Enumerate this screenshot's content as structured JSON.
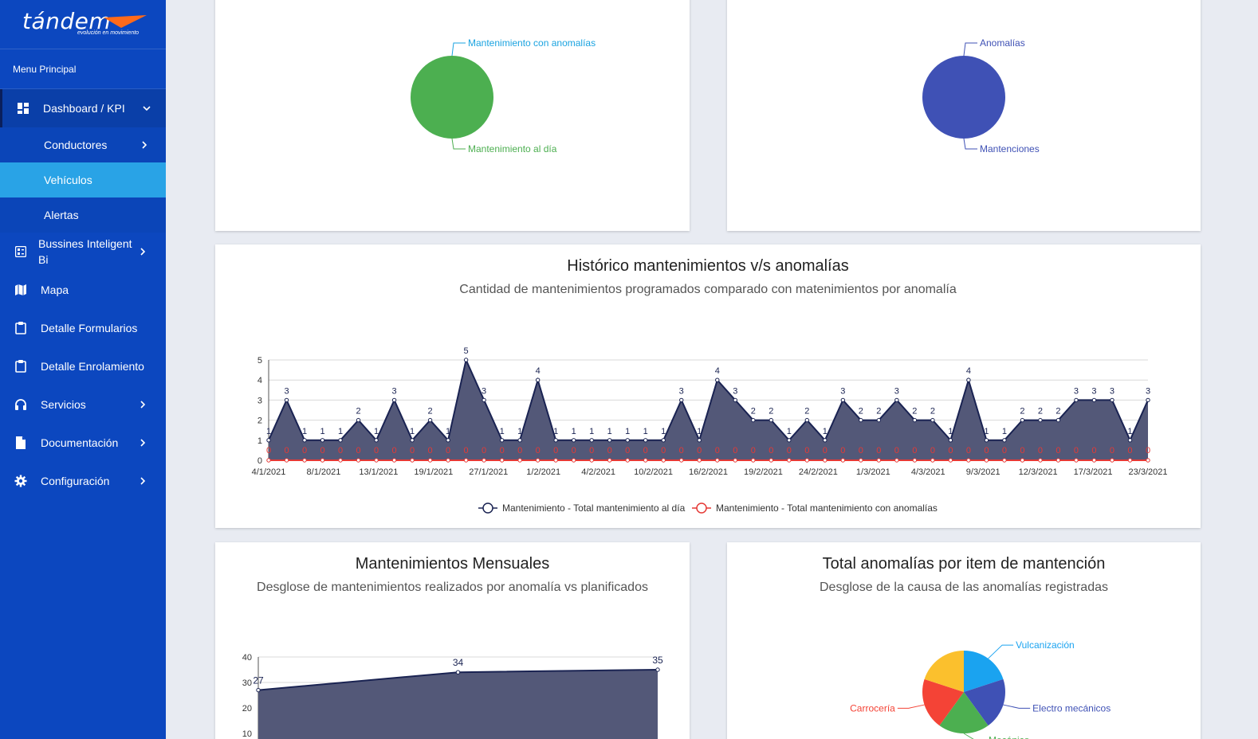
{
  "brand": {
    "name": "tándem",
    "tagline": "evolución en movimiento",
    "accent": "#ff6a1a"
  },
  "sidebar": {
    "header": "Menu Principal",
    "items": [
      {
        "label": "Dashboard / KPI",
        "icon": "dashboard-icon",
        "expanded": true
      },
      {
        "label": "Conductores",
        "sub": true,
        "chevron": true
      },
      {
        "label": "Vehículos",
        "sub": true,
        "selected": true
      },
      {
        "label": "Alertas",
        "sub": true
      },
      {
        "label": "Bussines Inteligent Bi",
        "icon": "bi-icon",
        "chevron": true
      },
      {
        "label": "Mapa",
        "icon": "map-icon"
      },
      {
        "label": "Detalle Formularios",
        "icon": "clipboard-icon"
      },
      {
        "label": "Detalle Enrolamiento",
        "icon": "clipboard-icon"
      },
      {
        "label": "Servicios",
        "icon": "headset-icon",
        "chevron": true
      },
      {
        "label": "Documentación",
        "icon": "document-icon",
        "chevron": true
      },
      {
        "label": "Configuración",
        "icon": "gear-icon",
        "chevron": true
      }
    ]
  },
  "pie_top_left": {
    "label_top": "Mantenimiento con anomalías",
    "label_bottom": "Mantenimiento al día",
    "color_top": "#1aa3e0",
    "color_bottom": "#4caf50"
  },
  "pie_top_right": {
    "label_top": "Anomalías",
    "label_bottom": "Mantenciones",
    "color": "#3f51b5"
  },
  "chart_data": [
    {
      "type": "area",
      "title": "Histórico mantenimientos v/s anomalías",
      "subtitle": "Cantidad de mantenimientos programados comparado con matenimientos por anomalía",
      "ylim": [
        0,
        5
      ],
      "yticks": [
        0,
        1,
        2,
        3,
        4,
        5
      ],
      "xticks": [
        "4/1/2021",
        "8/1/2021",
        "13/1/2021",
        "19/1/2021",
        "27/1/2021",
        "1/2/2021",
        "4/2/2021",
        "10/2/2021",
        "16/2/2021",
        "19/2/2021",
        "24/2/2021",
        "1/3/2021",
        "4/3/2021",
        "9/3/2021",
        "12/3/2021",
        "17/3/2021",
        "23/3/2021"
      ],
      "series": [
        {
          "name": "Mantenimiento - Total mantenimiento al día",
          "color": "#1a2352",
          "values": [
            1,
            3,
            1,
            1,
            1,
            2,
            1,
            3,
            1,
            2,
            1,
            5,
            3,
            1,
            1,
            4,
            1,
            1,
            1,
            1,
            1,
            1,
            1,
            3,
            1,
            4,
            3,
            2,
            2,
            1,
            2,
            1,
            3,
            2,
            2,
            3,
            2,
            2,
            1,
            4,
            1,
            1,
            2,
            2,
            2,
            3,
            3,
            3,
            1,
            3
          ]
        },
        {
          "name": "Mantenimiento - Total mantenimiento con anomalías",
          "color": "#e53935",
          "values": [
            0,
            0,
            0,
            0,
            0,
            0,
            0,
            0,
            0,
            0,
            0,
            0,
            0,
            0,
            0,
            0,
            0,
            0,
            0,
            0,
            0,
            0,
            0,
            0,
            0,
            0,
            0,
            0,
            0,
            0,
            0,
            0,
            0,
            0,
            0,
            0,
            0,
            0,
            0,
            0,
            0,
            0,
            0,
            0,
            0,
            0,
            0,
            0,
            0,
            0
          ]
        }
      ],
      "grid": true,
      "legend": "bottom"
    },
    {
      "type": "area",
      "title": "Mantenimientos Mensuales",
      "subtitle": "Desglose de mantenimientos realizados por anomalía vs planificados",
      "yticks": [
        10,
        20,
        30,
        40
      ],
      "ylim": [
        0,
        40
      ],
      "series": [
        {
          "color": "#1a2352",
          "values": [
            27,
            34,
            35
          ]
        }
      ]
    },
    {
      "type": "pie",
      "title": "Total anomalías por item de mantención",
      "subtitle": "Desglose de la causa de las anomalías registradas",
      "slices": [
        {
          "label": "Vulcanización",
          "value": 20,
          "color": "#1aa3f0"
        },
        {
          "label": "Electro mecánicos",
          "value": 20,
          "color": "#3f51b5"
        },
        {
          "label": "Mecánico",
          "value": 20,
          "color": "#4caf50"
        },
        {
          "label": "Carrocería",
          "value": 20,
          "color": "#f44336"
        },
        {
          "label": "",
          "value": 20,
          "color": "#fbc02d"
        }
      ]
    }
  ]
}
